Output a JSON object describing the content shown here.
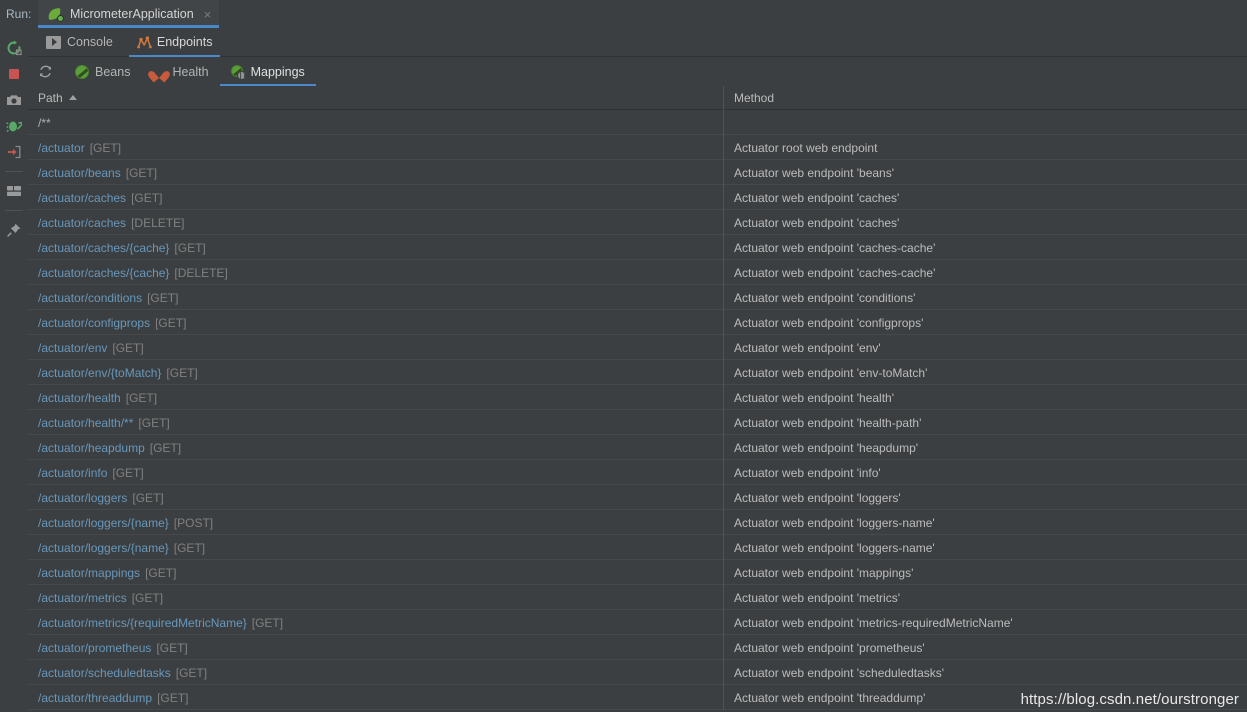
{
  "window": {
    "run_label": "Run:",
    "run_tab_title": "MicrometerApplication",
    "close_glyph": "×"
  },
  "left_toolbar": {
    "items": [
      {
        "name": "rerun-button",
        "title": "Rerun"
      },
      {
        "name": "stop-button",
        "title": "Stop"
      },
      {
        "name": "camera-button",
        "title": "Capture Snapshot"
      },
      {
        "name": "debug-button",
        "title": "Attach Debugger"
      },
      {
        "name": "export-button",
        "title": "Export"
      },
      {
        "name": "layout-button",
        "title": "Layout Settings"
      },
      {
        "name": "pin-button",
        "title": "Pin Tab"
      }
    ]
  },
  "sub_toolbar": {
    "items": [
      {
        "name": "refresh-button",
        "title": "Refresh"
      },
      {
        "name": "globe-button",
        "title": "Open in Browser"
      },
      {
        "name": "micrometer-button",
        "title": "Micrometer"
      },
      {
        "name": "metrics-button",
        "title": "Metrics",
        "selected": true
      }
    ]
  },
  "subtabs": {
    "items": [
      {
        "label": "Console",
        "icon": "console-icon",
        "active": false
      },
      {
        "label": "Endpoints",
        "icon": "endpoints-icon",
        "active": true
      }
    ]
  },
  "endpoint_tabs": {
    "refresh_title": "Refresh",
    "items": [
      {
        "label": "Beans",
        "icon": "beans-icon",
        "active": false
      },
      {
        "label": "Health",
        "icon": "health-icon",
        "active": false
      },
      {
        "label": "Mappings",
        "icon": "mappings-icon",
        "active": true
      }
    ]
  },
  "table": {
    "columns": [
      {
        "key": "path",
        "label": "Path",
        "sorted": "asc"
      },
      {
        "key": "method",
        "label": "Method",
        "sorted": null
      }
    ],
    "rows": [
      {
        "path": "/**",
        "verb": "",
        "link": false,
        "method": ""
      },
      {
        "path": "/actuator",
        "verb": "[GET]",
        "link": true,
        "method": "Actuator root web endpoint"
      },
      {
        "path": "/actuator/beans",
        "verb": "[GET]",
        "link": true,
        "method": "Actuator web endpoint 'beans'"
      },
      {
        "path": "/actuator/caches",
        "verb": "[GET]",
        "link": true,
        "method": "Actuator web endpoint 'caches'"
      },
      {
        "path": "/actuator/caches",
        "verb": "[DELETE]",
        "link": true,
        "method": "Actuator web endpoint 'caches'"
      },
      {
        "path": "/actuator/caches/{cache}",
        "verb": "[GET]",
        "link": true,
        "method": "Actuator web endpoint 'caches-cache'"
      },
      {
        "path": "/actuator/caches/{cache}",
        "verb": "[DELETE]",
        "link": true,
        "method": "Actuator web endpoint 'caches-cache'"
      },
      {
        "path": "/actuator/conditions",
        "verb": "[GET]",
        "link": true,
        "method": "Actuator web endpoint 'conditions'"
      },
      {
        "path": "/actuator/configprops",
        "verb": "[GET]",
        "link": true,
        "method": "Actuator web endpoint 'configprops'"
      },
      {
        "path": "/actuator/env",
        "verb": "[GET]",
        "link": true,
        "method": "Actuator web endpoint 'env'"
      },
      {
        "path": "/actuator/env/{toMatch}",
        "verb": "[GET]",
        "link": true,
        "method": "Actuator web endpoint 'env-toMatch'"
      },
      {
        "path": "/actuator/health",
        "verb": "[GET]",
        "link": true,
        "method": "Actuator web endpoint 'health'"
      },
      {
        "path": "/actuator/health/**",
        "verb": "[GET]",
        "link": true,
        "method": "Actuator web endpoint 'health-path'"
      },
      {
        "path": "/actuator/heapdump",
        "verb": "[GET]",
        "link": true,
        "method": "Actuator web endpoint 'heapdump'"
      },
      {
        "path": "/actuator/info",
        "verb": "[GET]",
        "link": true,
        "method": "Actuator web endpoint 'info'"
      },
      {
        "path": "/actuator/loggers",
        "verb": "[GET]",
        "link": true,
        "method": "Actuator web endpoint 'loggers'"
      },
      {
        "path": "/actuator/loggers/{name}",
        "verb": "[POST]",
        "link": true,
        "method": "Actuator web endpoint 'loggers-name'"
      },
      {
        "path": "/actuator/loggers/{name}",
        "verb": "[GET]",
        "link": true,
        "method": "Actuator web endpoint 'loggers-name'"
      },
      {
        "path": "/actuator/mappings",
        "verb": "[GET]",
        "link": true,
        "method": "Actuator web endpoint 'mappings'"
      },
      {
        "path": "/actuator/metrics",
        "verb": "[GET]",
        "link": true,
        "method": "Actuator web endpoint 'metrics'"
      },
      {
        "path": "/actuator/metrics/{requiredMetricName}",
        "verb": "[GET]",
        "link": true,
        "method": "Actuator web endpoint 'metrics-requiredMetricName'"
      },
      {
        "path": "/actuator/prometheus",
        "verb": "[GET]",
        "link": true,
        "method": "Actuator web endpoint 'prometheus'"
      },
      {
        "path": "/actuator/scheduledtasks",
        "verb": "[GET]",
        "link": true,
        "method": "Actuator web endpoint 'scheduledtasks'"
      },
      {
        "path": "/actuator/threaddump",
        "verb": "[GET]",
        "link": true,
        "method": "Actuator web endpoint 'threaddump'"
      }
    ]
  },
  "watermark": {
    "text": "https://blog.csdn.net/ourstronger"
  },
  "colors": {
    "background": "#3c3f41",
    "accent": "#4a88c7",
    "link": "#6897bb",
    "muted": "#808080",
    "text": "#bbbbbb",
    "green": "#5c9e3a",
    "red": "#c75b3c",
    "pink": "#c1687c"
  }
}
